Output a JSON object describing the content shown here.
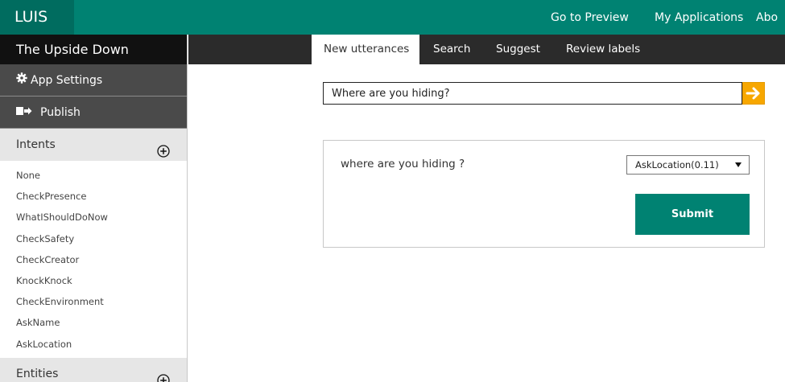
{
  "header": {
    "logo": "LUIS",
    "nav": [
      "Go to Preview",
      "My Applications",
      "Abo"
    ]
  },
  "sidebar": {
    "app_name": "The Upside Down",
    "app_settings_label": "App Settings",
    "publish_label": "Publish",
    "intents_header": "Intents",
    "intents": [
      "None",
      "CheckPresence",
      "WhatIShouldDoNow",
      "CheckSafety",
      "CheckCreator",
      "KnockKnock",
      "CheckEnvironment",
      "AskName",
      "AskLocation"
    ],
    "entities_header": "Entities"
  },
  "tabs": [
    "New utterances",
    "Search",
    "Suggest",
    "Review labels"
  ],
  "utterance_input": {
    "value": "Where are you hiding?"
  },
  "card": {
    "utterance_text": "where are you hiding ?",
    "selected_intent": "AskLocation(0.11)",
    "submit_label": "Submit"
  },
  "colors": {
    "brand_teal": "#008272",
    "arrow_button": "#f7a700"
  }
}
